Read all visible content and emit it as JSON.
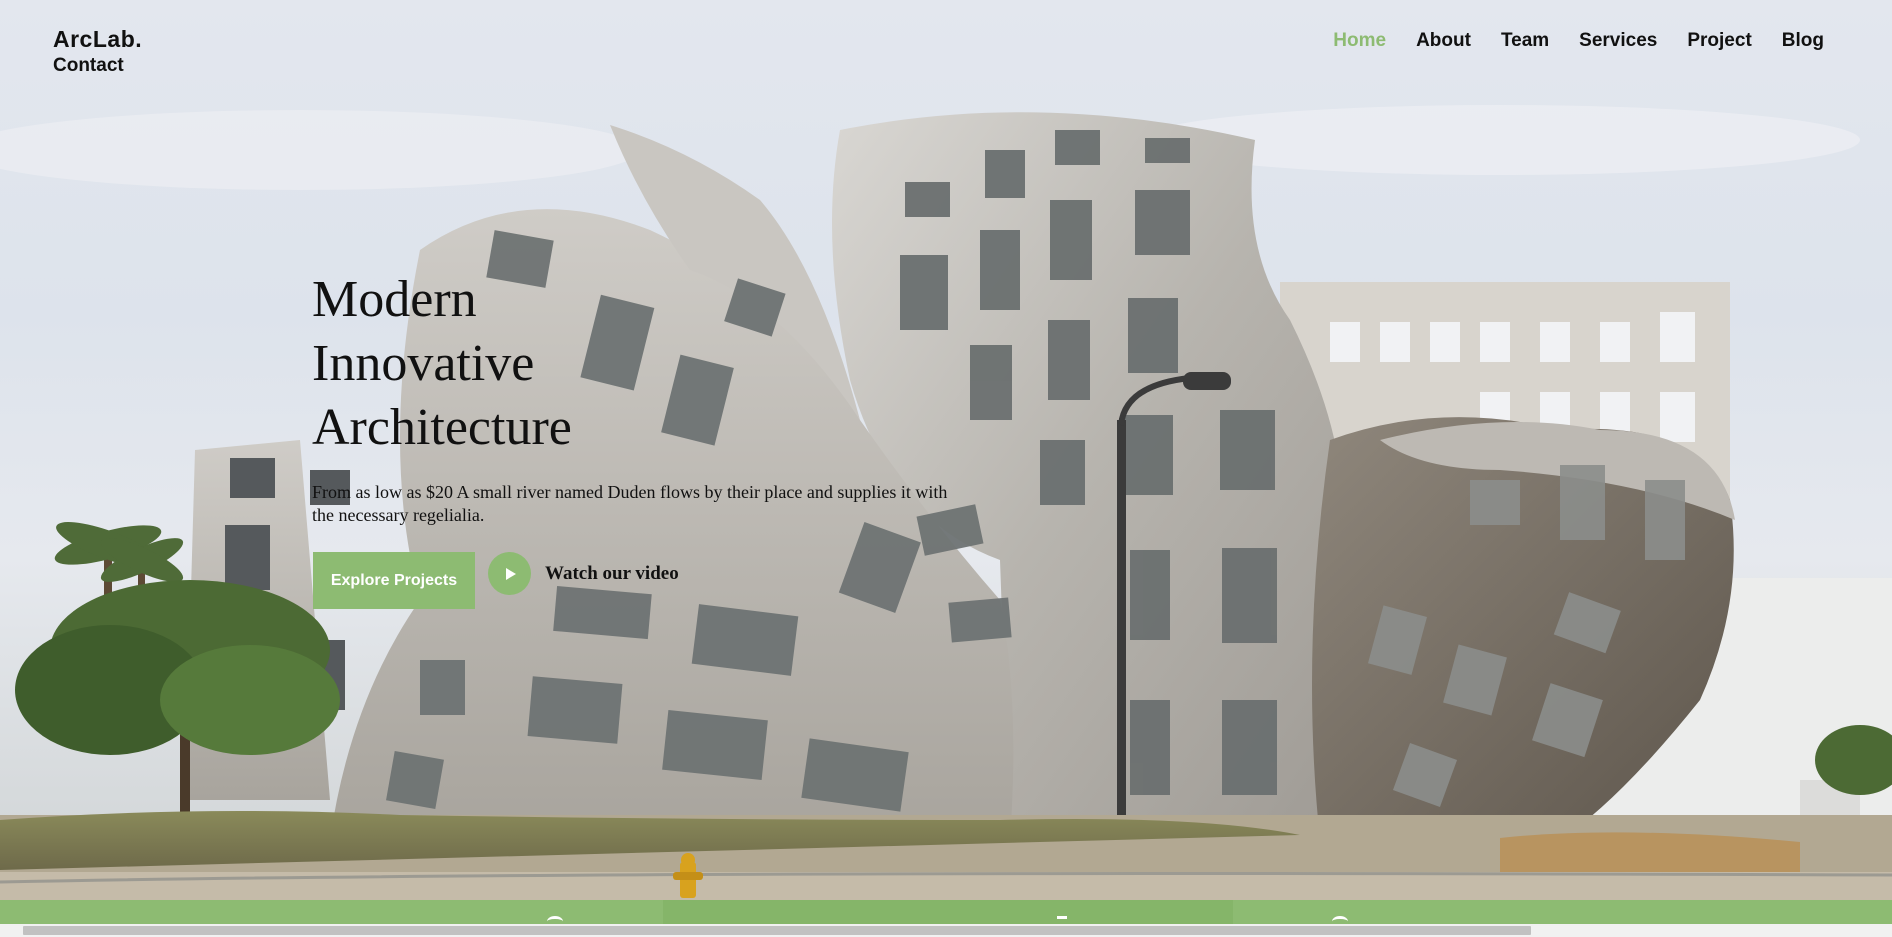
{
  "brand": {
    "name": "ArcLab.",
    "sub_link": "Contact"
  },
  "nav": {
    "items": [
      {
        "label": "Home",
        "active": true
      },
      {
        "label": "About",
        "active": false
      },
      {
        "label": "Team",
        "active": false
      },
      {
        "label": "Services",
        "active": false
      },
      {
        "label": "Project",
        "active": false
      },
      {
        "label": "Blog",
        "active": false
      }
    ]
  },
  "hero": {
    "headline_lines": [
      "Modern",
      "Innovative",
      "Architecture"
    ],
    "tagline": "From as low as $20 A small river named Duden flows by their place and supplies it with the necessary regelialia.",
    "explore_button": "Explore Projects",
    "play_icon": "play-icon",
    "video_link": "Watch our video"
  },
  "colors": {
    "accent": "#8dbb72",
    "text": "#111111",
    "sky": "#e3e7ee",
    "metal": "#b8b6b2"
  }
}
